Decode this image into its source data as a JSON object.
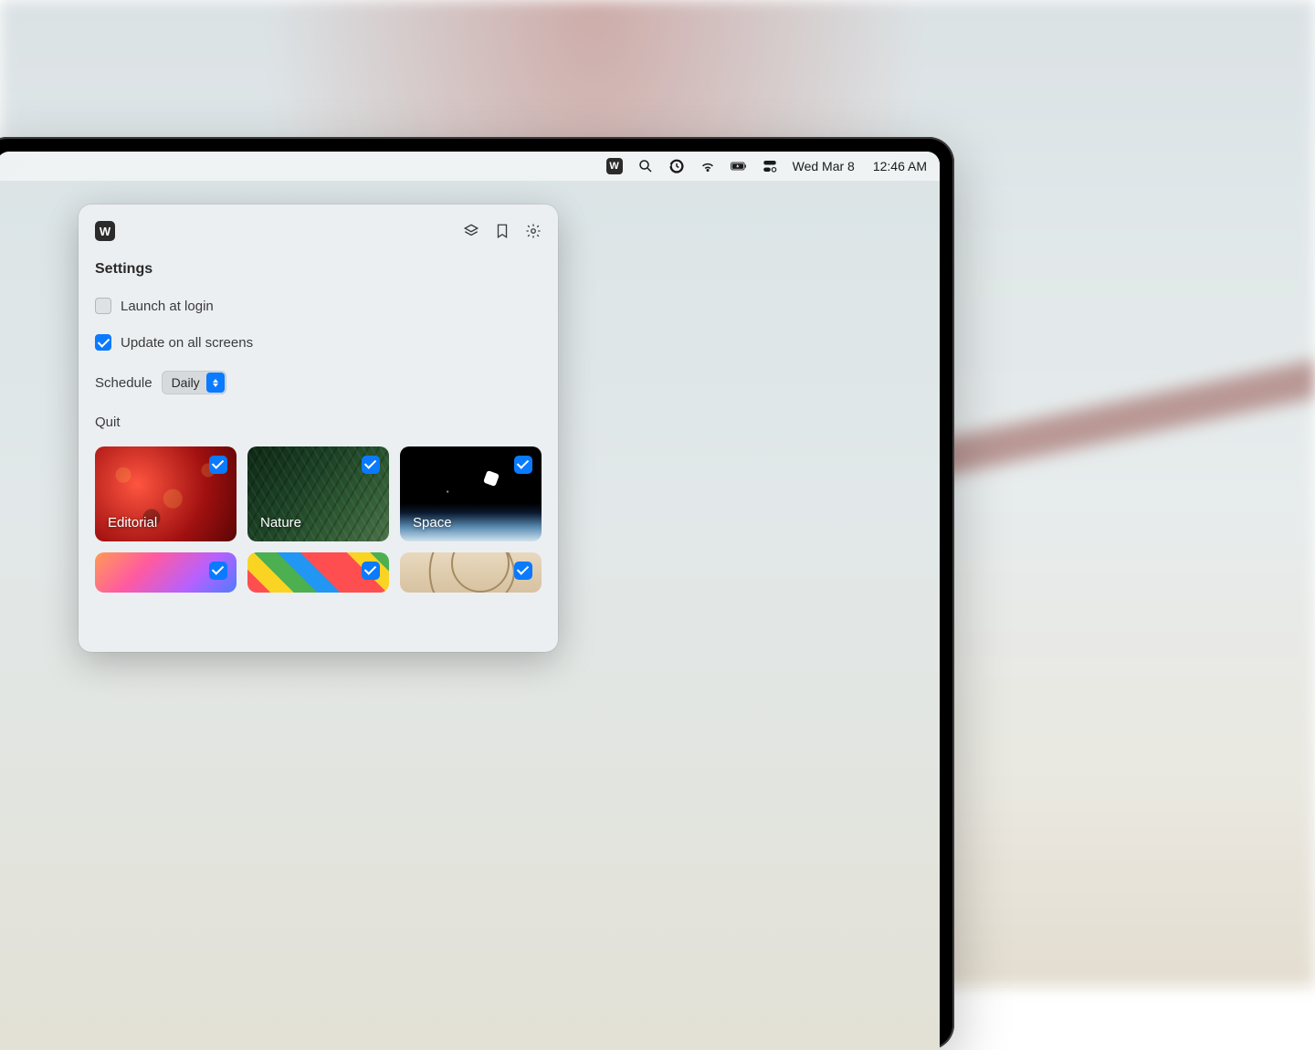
{
  "menubar": {
    "app_letter": "W",
    "date": "Wed Mar 8",
    "time": "12:46 AM"
  },
  "popover": {
    "app_letter": "W",
    "title": "Settings",
    "launch_at_login": {
      "label": "Launch at login",
      "checked": false
    },
    "update_all": {
      "label": "Update on all screens",
      "checked": true
    },
    "schedule_label": "Schedule",
    "schedule_value": "Daily",
    "quit_label": "Quit",
    "cards": [
      {
        "label": "Editorial",
        "checked": true,
        "bg": "bg-editorial"
      },
      {
        "label": "Nature",
        "checked": true,
        "bg": "bg-nature"
      },
      {
        "label": "Space",
        "checked": true,
        "bg": "bg-space"
      },
      {
        "label": "",
        "checked": true,
        "bg": "bg-wallpapers",
        "half": true
      },
      {
        "label": "",
        "checked": true,
        "bg": "bg-3d",
        "half": true
      },
      {
        "label": "",
        "checked": true,
        "bg": "bg-sports",
        "half": true
      }
    ]
  }
}
